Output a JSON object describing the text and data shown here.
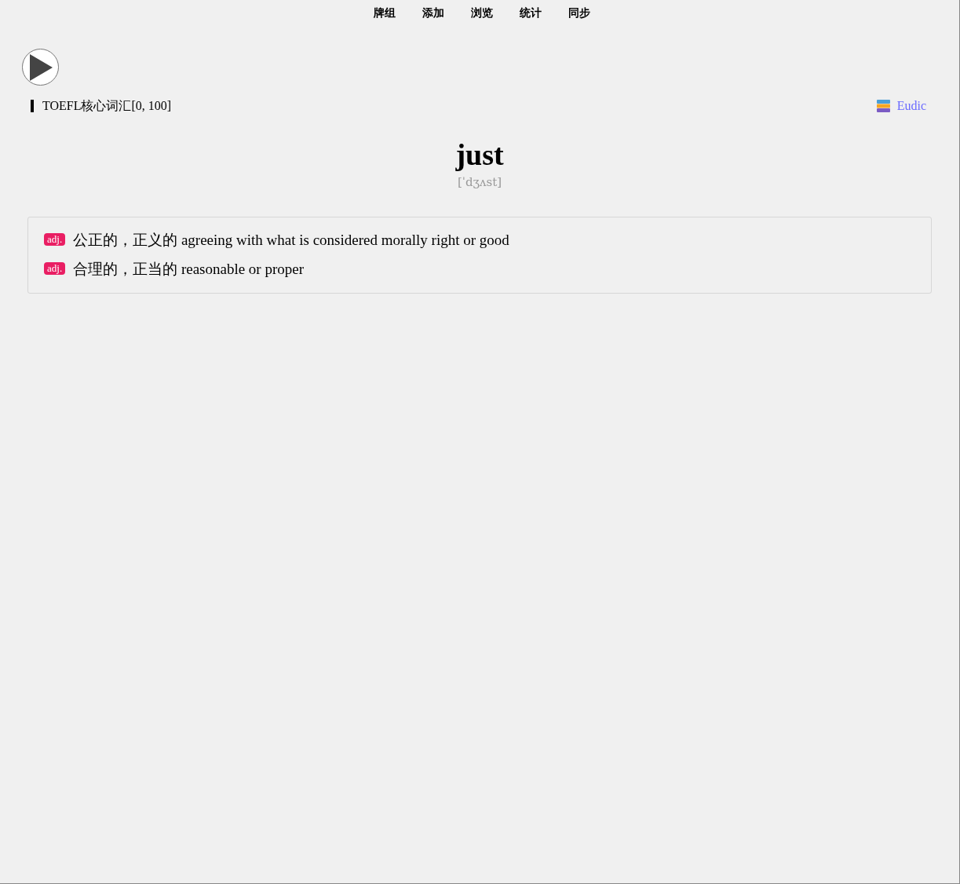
{
  "nav": [
    {
      "label": "牌组"
    },
    {
      "label": "添加"
    },
    {
      "label": "浏览"
    },
    {
      "label": "统计"
    },
    {
      "label": "同步"
    }
  ],
  "deck": "TOEFL核心词汇[0, 100]",
  "dict_link": "Eudic",
  "word": "just",
  "phonetic": "[ˈdʒʌst]",
  "definitions": [
    {
      "pos": "adj.",
      "text": "公正的，正义的 agreeing with what is considered morally right or good"
    },
    {
      "pos": "adj.",
      "text": "合理的，正当的 reasonable or proper"
    }
  ]
}
